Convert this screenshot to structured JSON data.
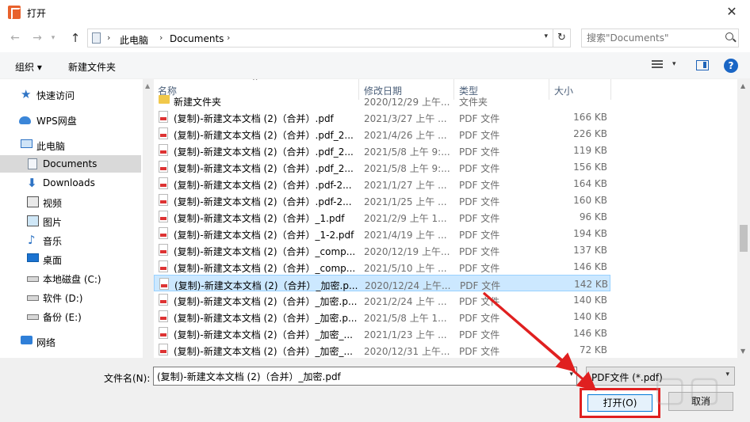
{
  "window": {
    "title": "打开",
    "close_glyph": "✕"
  },
  "address": {
    "crumbs": [
      "此电脑",
      "Documents"
    ],
    "search_placeholder": "搜索\"Documents\""
  },
  "toolbar": {
    "organize": "组织 ▾",
    "new_folder": "新建文件夹"
  },
  "nav": {
    "items": [
      {
        "label": "快速访问",
        "icon": "star-icon"
      },
      {
        "label": "WPS网盘",
        "icon": "cloud-icon"
      },
      {
        "label": "此电脑",
        "icon": "computer-icon"
      },
      {
        "label": "Documents",
        "icon": "documents-icon",
        "selected": true
      },
      {
        "label": "Downloads",
        "icon": "download-icon"
      },
      {
        "label": "视频",
        "icon": "video-icon"
      },
      {
        "label": "图片",
        "icon": "pictures-icon"
      },
      {
        "label": "音乐",
        "icon": "music-icon"
      },
      {
        "label": "桌面",
        "icon": "desktop-icon"
      },
      {
        "label": "本地磁盘 (C:)",
        "icon": "drive-icon"
      },
      {
        "label": "软件 (D:)",
        "icon": "drive-icon"
      },
      {
        "label": "备份 (E:)",
        "icon": "drive-icon"
      },
      {
        "label": "网络",
        "icon": "network-icon"
      }
    ]
  },
  "columns": {
    "name": "名称",
    "date": "修改日期",
    "type": "类型",
    "size": "大小"
  },
  "files": [
    {
      "name": "新建文件夹",
      "date": "2020/12/29 上午...",
      "type": "文件夹",
      "size": "",
      "kind": "folder"
    },
    {
      "name": "(复制)-新建文本文档 (2)（合并）.pdf",
      "date": "2021/3/27 上午 ...",
      "type": "PDF 文件",
      "size": "166 KB"
    },
    {
      "name": "(复制)-新建文本文档 (2)（合并）.pdf_2...",
      "date": "2021/4/26 上午 ...",
      "type": "PDF 文件",
      "size": "226 KB"
    },
    {
      "name": "(复制)-新建文本文档 (2)（合并）.pdf_2...",
      "date": "2021/5/8 上午 9:...",
      "type": "PDF 文件",
      "size": "119 KB"
    },
    {
      "name": "(复制)-新建文本文档 (2)（合并）.pdf_2...",
      "date": "2021/5/8 上午 9:...",
      "type": "PDF 文件",
      "size": "156 KB"
    },
    {
      "name": "(复制)-新建文本文档 (2)（合并）.pdf-2...",
      "date": "2021/1/27 上午 ...",
      "type": "PDF 文件",
      "size": "164 KB"
    },
    {
      "name": "(复制)-新建文本文档 (2)（合并）.pdf-2...",
      "date": "2021/1/25 上午 ...",
      "type": "PDF 文件",
      "size": "160 KB"
    },
    {
      "name": "(复制)-新建文本文档 (2)（合并）_1.pdf",
      "date": "2021/2/9 上午 1...",
      "type": "PDF 文件",
      "size": "96 KB"
    },
    {
      "name": "(复制)-新建文本文档 (2)（合并）_1-2.pdf",
      "date": "2021/4/19 上午 ...",
      "type": "PDF 文件",
      "size": "194 KB"
    },
    {
      "name": "(复制)-新建文本文档 (2)（合并）_comp...",
      "date": "2020/12/19 上午...",
      "type": "PDF 文件",
      "size": "137 KB"
    },
    {
      "name": "(复制)-新建文本文档 (2)（合并）_comp...",
      "date": "2021/5/10 上午 ...",
      "type": "PDF 文件",
      "size": "146 KB"
    },
    {
      "name": "(复制)-新建文本文档 (2)（合并）_加密.p...",
      "date": "2020/12/24 上午...",
      "type": "PDF 文件",
      "size": "142 KB",
      "selected": true
    },
    {
      "name": "(复制)-新建文本文档 (2)（合并）_加密.p...",
      "date": "2021/2/24 上午 ...",
      "type": "PDF 文件",
      "size": "140 KB"
    },
    {
      "name": "(复制)-新建文本文档 (2)（合并）_加密.p...",
      "date": "2021/5/8 上午 1...",
      "type": "PDF 文件",
      "size": "140 KB"
    },
    {
      "name": "(复制)-新建文本文档 (2)（合并）_加密_...",
      "date": "2021/1/23 上午 ...",
      "type": "PDF 文件",
      "size": "146 KB"
    },
    {
      "name": "(复制)-新建文本文档 (2)（合并）_加密_...",
      "date": "2020/12/31 上午...",
      "type": "PDF 文件",
      "size": "72 KB"
    }
  ],
  "bottom": {
    "filename_label": "文件名(N):",
    "filename_value": "(复制)-新建文本文档 (2)（合并）_加密.pdf",
    "filetype": "PDF文件 (*.pdf)",
    "open_label": "打开(O)",
    "cancel_label": "取消"
  },
  "colors": {
    "accent": "#0078d7",
    "highlight": "#e02020",
    "selection": "#cce8ff"
  }
}
